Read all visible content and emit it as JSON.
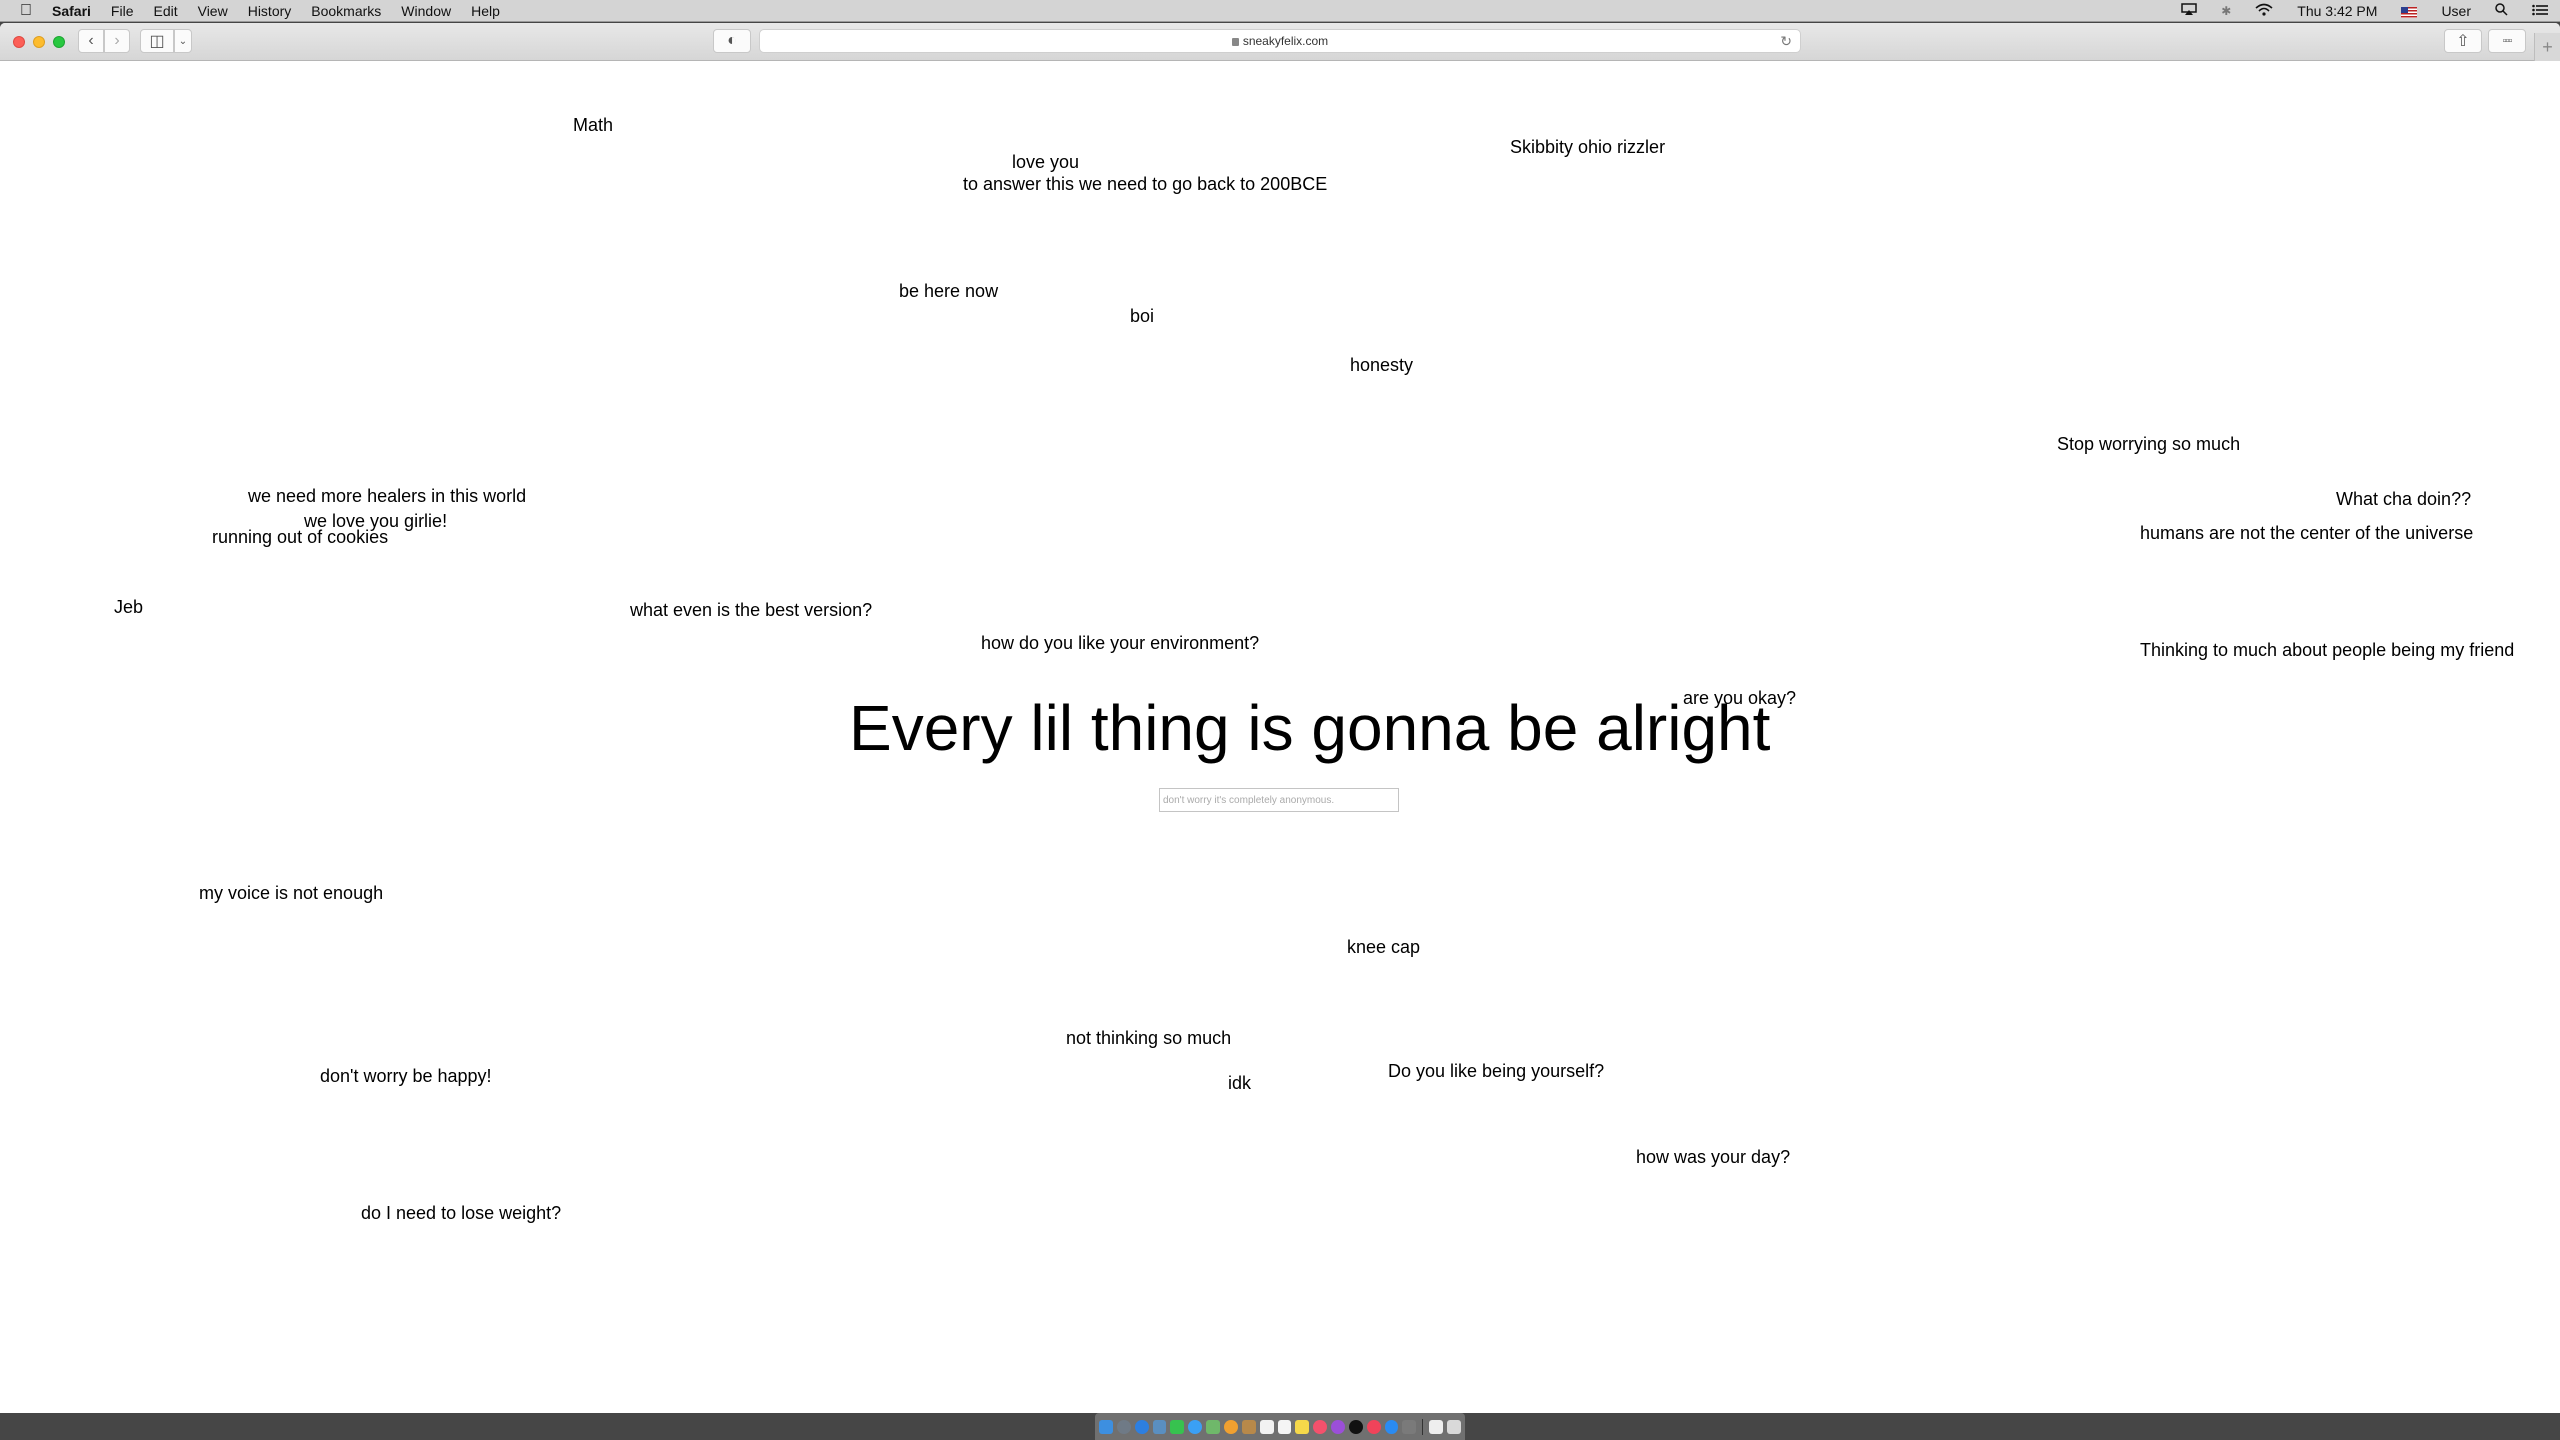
{
  "menubar": {
    "apple_icon": "",
    "app_name": "Safari",
    "menus": [
      "File",
      "Edit",
      "View",
      "History",
      "Bookmarks",
      "Window",
      "Help"
    ],
    "status": {
      "airplay_icon": "airplay-icon",
      "bluetooth_icon": "bluetooth-icon",
      "wifi_icon": "wifi-icon",
      "clock": "Thu 3:42 PM",
      "input_source_icon": "us-flag-icon",
      "user": "User",
      "spotlight_icon": "search-icon",
      "notification_icon": "list-icon"
    }
  },
  "toolbar": {
    "back_glyph": "‹",
    "forward_glyph": "›",
    "sidebar_glyph": "◫",
    "sidebar_menu_glyph": "⌄",
    "shield_glyph": "◐",
    "url": "sneakyfelix.com",
    "reload_glyph": "↻",
    "share_glyph": "⇧",
    "tabs_glyph": "▫▫▫",
    "new_tab_glyph": "+"
  },
  "page": {
    "headline": "Every lil thing is gonna be alright",
    "input_placeholder": "don't worry it's completely anonymous.",
    "input_value": "",
    "messages": [
      "Math",
      "love you",
      "to answer this we need to go back to 200BCE",
      "Skibbity ohio rizzler",
      "be here now",
      "boi",
      "honesty",
      "Stop worrying so much",
      "we need more healers in this world",
      "we love you girlie!",
      "running out of cookies",
      "What cha doin??",
      "humans are not the center of the universe",
      "Jeb",
      "what even is the best version?",
      "how do you like your environment?",
      "Thinking to much about people being my friend",
      "are you okay?",
      "my voice is not enough",
      "knee cap",
      "not thinking so much",
      "Do you like being yourself?",
      "don't worry be happy!",
      "idk",
      "how was your day?",
      "do I need to lose weight?"
    ]
  },
  "dock": {
    "apps": [
      {
        "name": "finder-icon",
        "color": "#3d8fe0"
      },
      {
        "name": "launchpad-icon",
        "color": "#6f7a86"
      },
      {
        "name": "safari-icon",
        "color": "#2d7fe0"
      },
      {
        "name": "preview-icon",
        "color": "#5a8fc0"
      },
      {
        "name": "facetime-icon",
        "color": "#37c24f"
      },
      {
        "name": "messages-icon",
        "color": "#3aa0f5"
      },
      {
        "name": "maps-icon",
        "color": "#6fb86a"
      },
      {
        "name": "photos-icon",
        "color": "#f0a030"
      },
      {
        "name": "contacts-icon",
        "color": "#b8894a"
      },
      {
        "name": "calendar-icon",
        "color": "#f2f2f2"
      },
      {
        "name": "reminders-icon",
        "color": "#f5f5f5"
      },
      {
        "name": "notes-icon",
        "color": "#f6d84a"
      },
      {
        "name": "music-icon",
        "color": "#f4516c"
      },
      {
        "name": "podcasts-icon",
        "color": "#9b4fd8"
      },
      {
        "name": "tv-icon",
        "color": "#111111"
      },
      {
        "name": "news-icon",
        "color": "#f0435a"
      },
      {
        "name": "app-store-icon",
        "color": "#2a8bf2"
      },
      {
        "name": "system-preferences-icon",
        "color": "#7a7a7a"
      }
    ],
    "trailing": [
      {
        "name": "downloads-icon",
        "color": "#eeeeee"
      },
      {
        "name": "trash-icon",
        "color": "#d9d9d9"
      }
    ]
  }
}
